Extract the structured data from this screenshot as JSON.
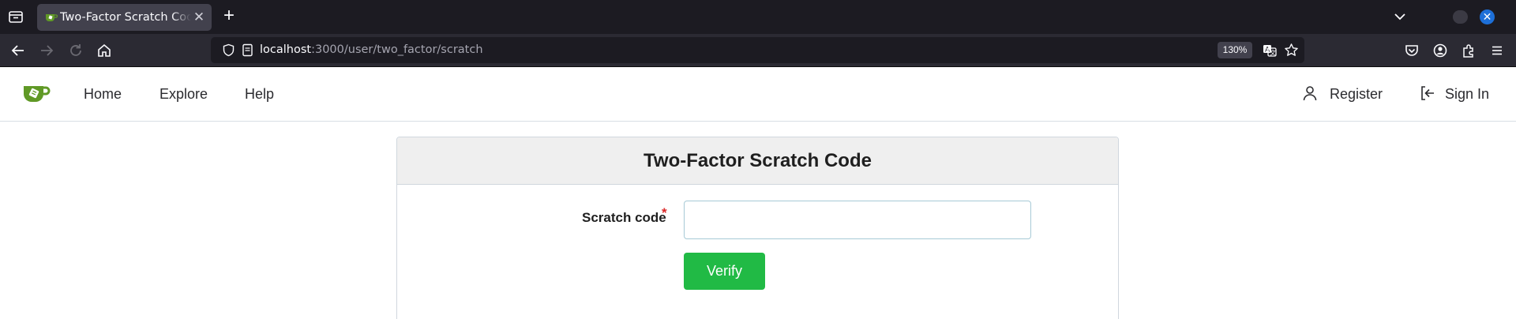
{
  "browser": {
    "tab_title": "Two-Factor Scratch Code",
    "tab_close": "✕",
    "new_tab": "+",
    "url_host": "localhost",
    "url_path": ":3000/user/two_factor/scratch",
    "zoom": "130%"
  },
  "nav": {
    "links": [
      "Home",
      "Explore",
      "Help"
    ],
    "register": "Register",
    "sign_in": "Sign In"
  },
  "form": {
    "title": "Two-Factor Scratch Code",
    "label": "Scratch code",
    "required_marker": "*",
    "input_value": "",
    "verify_label": "Verify"
  },
  "colors": {
    "brand_green": "#609926",
    "verify_button": "#21ba45",
    "required": "#db2828"
  }
}
